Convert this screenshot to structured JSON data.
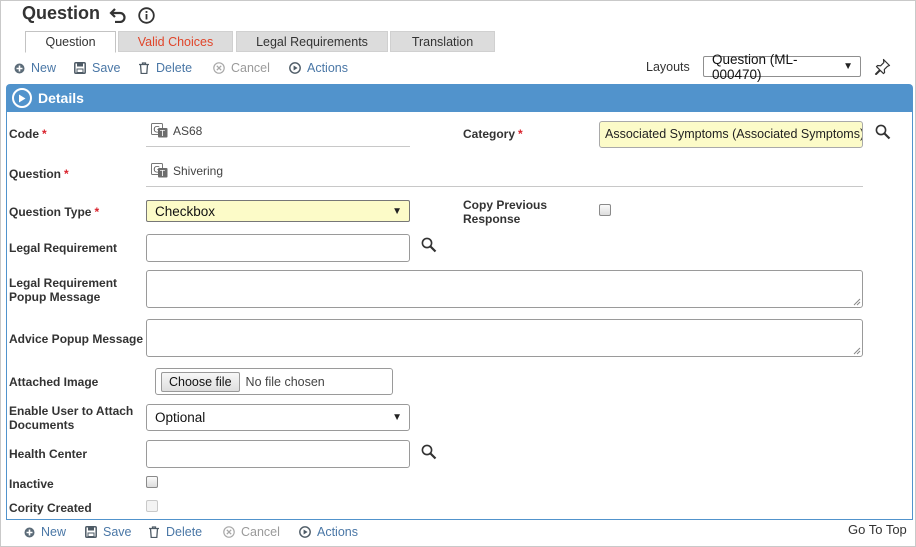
{
  "header": {
    "title": "Question",
    "back_icon": "undo-arrow-icon",
    "info_icon": "info-circle-icon"
  },
  "tabs": [
    {
      "label": "Question",
      "active": true
    },
    {
      "label": "Valid Choices",
      "highlight_color": "#e0452a"
    },
    {
      "label": "Legal Requirements"
    },
    {
      "label": "Translation"
    }
  ],
  "toolbar": {
    "new": "New",
    "save": "Save",
    "delete": "Delete",
    "cancel": "Cancel",
    "actions": "Actions"
  },
  "layouts": {
    "label": "Layouts",
    "selected": "Question (ML-000470)"
  },
  "panel": {
    "title": "Details",
    "header_color": "#5193cc"
  },
  "form": {
    "code": {
      "label": "Code",
      "value": "AS68"
    },
    "category": {
      "label": "Category",
      "value": "Associated Symptoms (Associated Symptoms)"
    },
    "question": {
      "label": "Question",
      "value": "Shivering"
    },
    "question_type": {
      "label": "Question Type",
      "value": "Checkbox"
    },
    "copy_previous": {
      "label_line1": "Copy Previous",
      "label_line2": "Response",
      "checked": false
    },
    "legal_requirement": {
      "label": "Legal Requirement",
      "value": ""
    },
    "legal_popup": {
      "label_line1": "Legal Requirement",
      "label_line2": "Popup Message",
      "value": ""
    },
    "advice_popup": {
      "label": "Advice Popup Message",
      "value": ""
    },
    "attached_image": {
      "label": "Attached Image",
      "button": "Choose file",
      "status": "No file chosen"
    },
    "enable_attach": {
      "label_line1": "Enable User to Attach",
      "label_line2": "Documents",
      "value": "Optional"
    },
    "health_center": {
      "label": "Health Center",
      "value": ""
    },
    "inactive": {
      "label": "Inactive",
      "checked": false
    },
    "cority_created": {
      "label": "Cority Created",
      "checked": false
    }
  },
  "required_marker": "*",
  "go_to_top": "Go To Top"
}
